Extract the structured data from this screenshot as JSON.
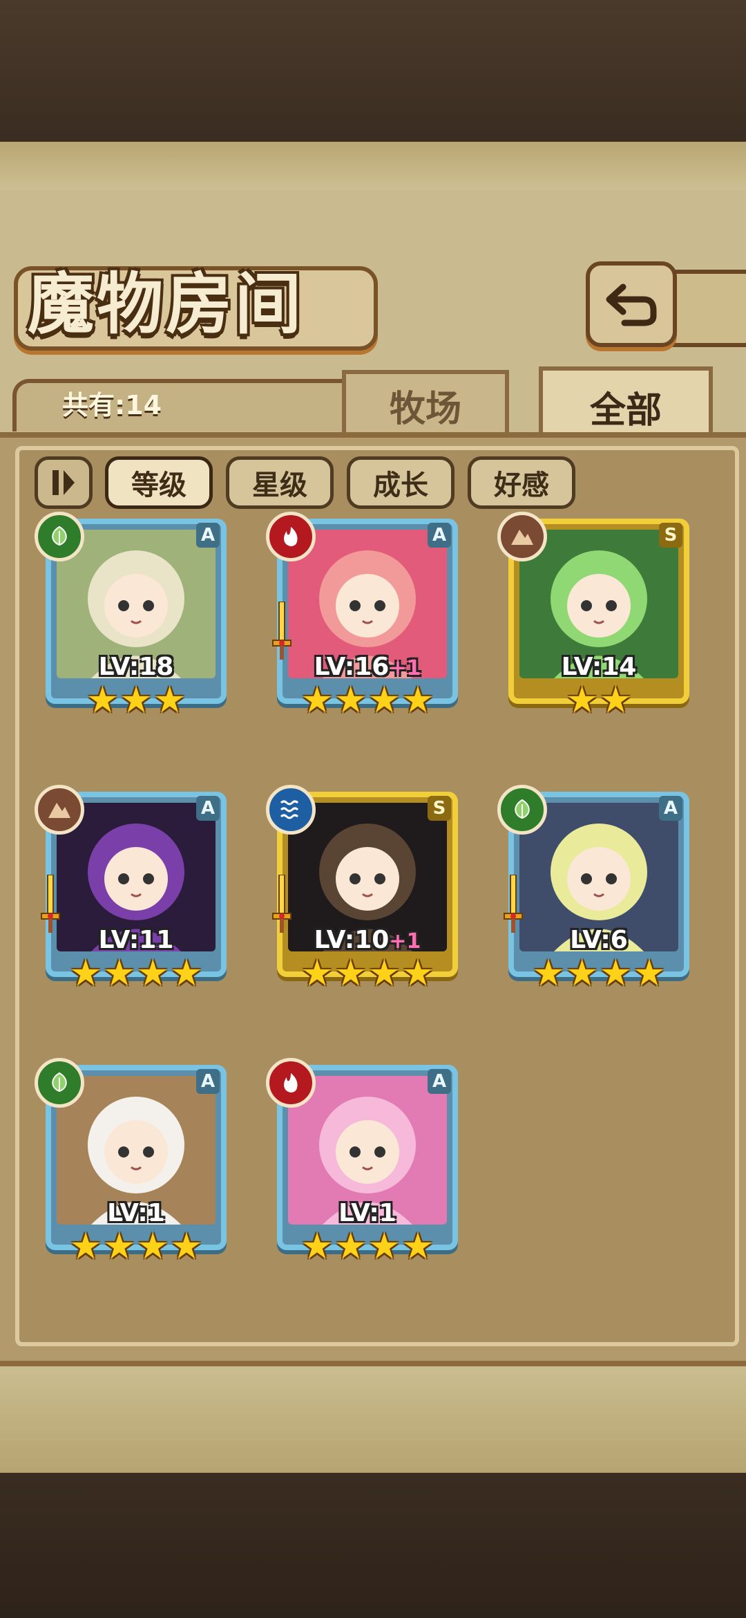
{
  "header": {
    "title": "魔物房间"
  },
  "summary": {
    "count_label": "共有:14"
  },
  "tabs": [
    {
      "label": "牧场",
      "active": false
    },
    {
      "label": "全部",
      "active": true
    }
  ],
  "sort_buttons": [
    {
      "label": "等级",
      "selected": true
    },
    {
      "label": "星级",
      "selected": false
    },
    {
      "label": "成长",
      "selected": false
    },
    {
      "label": "好感",
      "selected": false
    }
  ],
  "monsters": [
    {
      "element": "leaf",
      "rank": "A",
      "frame": "blue",
      "level": "LV:18",
      "plus": "",
      "stars": 3,
      "sword": false,
      "colors": [
        "#e9e3c8",
        "#9fb27a"
      ]
    },
    {
      "element": "fire",
      "rank": "A",
      "frame": "blue",
      "level": "LV:16",
      "plus": "+1",
      "stars": 4,
      "sword": true,
      "colors": [
        "#f29a9a",
        "#e35b7a"
      ]
    },
    {
      "element": "earth",
      "rank": "S",
      "frame": "gold",
      "level": "LV:14",
      "plus": "",
      "stars": 2,
      "sword": false,
      "colors": [
        "#8fd874",
        "#3e7b3a"
      ]
    },
    {
      "element": "earth",
      "rank": "A",
      "frame": "blue",
      "level": "LV:11",
      "plus": "",
      "stars": 4,
      "sword": true,
      "colors": [
        "#7a3fa8",
        "#2a1c3a"
      ]
    },
    {
      "element": "water",
      "rank": "S",
      "frame": "gold",
      "level": "LV:10",
      "plus": "+1",
      "stars": 4,
      "sword": true,
      "colors": [
        "#5a4433",
        "#1f1a1c"
      ]
    },
    {
      "element": "leaf",
      "rank": "A",
      "frame": "blue",
      "level": "LV:6",
      "plus": "",
      "stars": 4,
      "sword": true,
      "colors": [
        "#e9ea9a",
        "#3f4c6a"
      ]
    },
    {
      "element": "leaf",
      "rank": "A",
      "frame": "blue",
      "level": "LV:1",
      "plus": "",
      "stars": 4,
      "sword": false,
      "colors": [
        "#f4f1ec",
        "#a7835a"
      ]
    },
    {
      "element": "fire",
      "rank": "A",
      "frame": "blue",
      "level": "LV:1",
      "plus": "",
      "stars": 4,
      "sword": false,
      "colors": [
        "#f7b9d9",
        "#e27ab3"
      ]
    }
  ]
}
